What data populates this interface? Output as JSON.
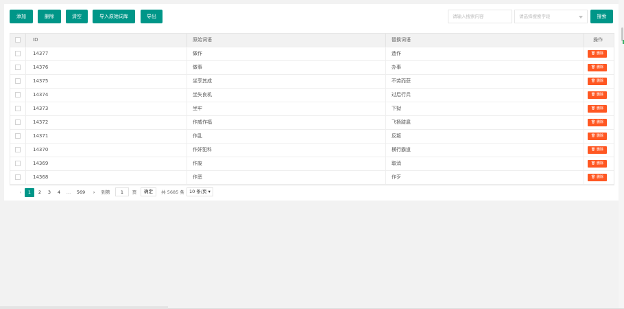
{
  "toolbar": {
    "add_label": "添加",
    "delete_label": "删除",
    "clear_label": "清空",
    "import_label": "导入原始词库",
    "export_label": "导出",
    "search_placeholder": "请输入搜索内容",
    "field_placeholder": "请选择搜索字段",
    "search_label": "搜索"
  },
  "table": {
    "columns": {
      "id": "ID",
      "original": "原始词语",
      "replace": "替换词语",
      "action": "操作"
    },
    "delete_label": "删除",
    "rows": [
      {
        "id": "14377",
        "original": "做作",
        "replace": "造作"
      },
      {
        "id": "14376",
        "original": "做事",
        "replace": "办事"
      },
      {
        "id": "14375",
        "original": "坐享其成",
        "replace": "不劳而获"
      },
      {
        "id": "14374",
        "original": "坐失良机",
        "replace": "过后行兵"
      },
      {
        "id": "14373",
        "original": "坐牢",
        "replace": "下狱"
      },
      {
        "id": "14372",
        "original": "作威作福",
        "replace": "飞扬跋扈"
      },
      {
        "id": "14371",
        "original": "作乱",
        "replace": "反叛"
      },
      {
        "id": "14370",
        "original": "作奸犯科",
        "replace": "横行霸道"
      },
      {
        "id": "14369",
        "original": "作废",
        "replace": "取消"
      },
      {
        "id": "14368",
        "original": "作恶",
        "replace": "作歹"
      }
    ]
  },
  "pager": {
    "prev": "‹",
    "pages": [
      "1",
      "2",
      "3",
      "4"
    ],
    "ellipsis": "…",
    "last": "569",
    "next": "›",
    "goto_label": "到第",
    "goto_value": "1",
    "page_unit": "页",
    "confirm_label": "确定",
    "total_text": "共 5685 条",
    "per_page": "10 条/页"
  },
  "colors": {
    "primary": "#009688",
    "danger": "#ff5722"
  }
}
